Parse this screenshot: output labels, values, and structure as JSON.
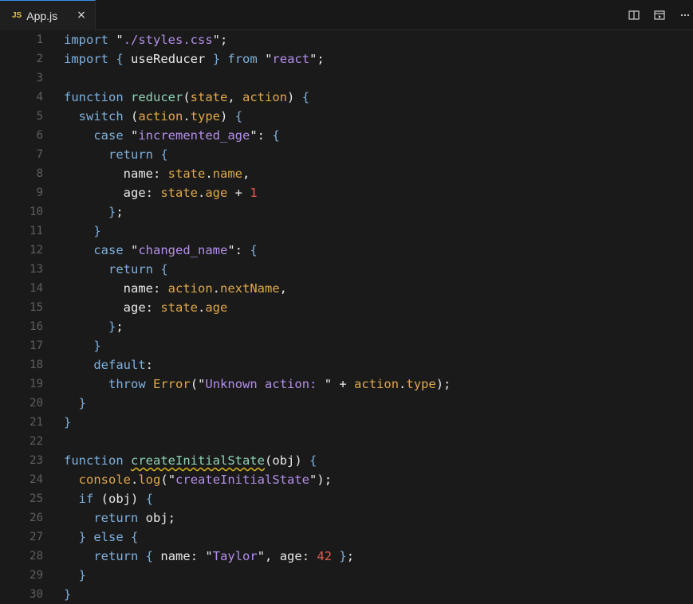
{
  "tab": {
    "language_badge": "JS",
    "title": "App.js",
    "close_glyph": "×"
  },
  "toolbar": {
    "icons": [
      "split-editor-icon",
      "open-preview-icon",
      "more-actions-icon"
    ]
  },
  "code_lines": [
    "import \"./styles.css\";",
    "import { useReducer } from \"react\";",
    "",
    "function reducer(state, action) {",
    "  switch (action.type) {",
    "    case \"incremented_age\": {",
    "      return {",
    "        name: state.name,",
    "        age: state.age + 1",
    "      };",
    "    }",
    "    case \"changed_name\": {",
    "      return {",
    "        name: action.nextName,",
    "        age: state.age",
    "      };",
    "    }",
    "    default:",
    "      throw Error(\"Unknown action: \" + action.type);",
    "  }",
    "}",
    "",
    "function createInitialState(obj) {",
    "  console.log(\"createInitialState\");",
    "  if (obj) {",
    "    return obj;",
    "  } else {",
    "    return { name: \"Taylor\", age: 42 };",
    "  }",
    "}"
  ],
  "line_numbers": [
    "1",
    "2",
    "3",
    "4",
    "5",
    "6",
    "7",
    "8",
    "9",
    "10",
    "11",
    "12",
    "13",
    "14",
    "15",
    "16",
    "17",
    "18",
    "19",
    "20",
    "21",
    "22",
    "23",
    "24",
    "25",
    "26",
    "27",
    "28",
    "29",
    "30"
  ]
}
